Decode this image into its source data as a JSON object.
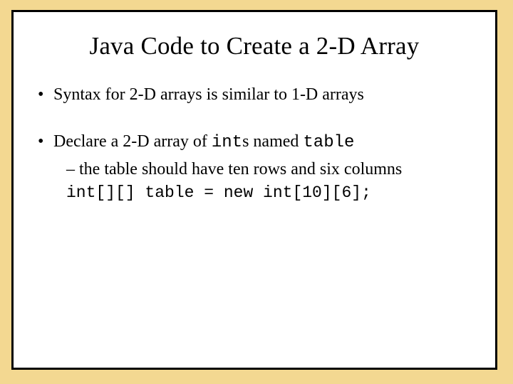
{
  "slide": {
    "title": "Java Code to Create a 2-D Array",
    "bullets": [
      {
        "text": "Syntax for 2-D arrays is similar to 1-D arrays",
        "sub": []
      },
      {
        "parts": {
          "pre": "Declare a 2-D array of ",
          "mono1": "int",
          "mid": "s named ",
          "mono2": "table"
        },
        "sub": [
          {
            "kind": "dash",
            "text": "the table should have ten rows and six columns"
          },
          {
            "kind": "code",
            "text": "int[][] table = new int[10][6];"
          }
        ]
      }
    ]
  }
}
